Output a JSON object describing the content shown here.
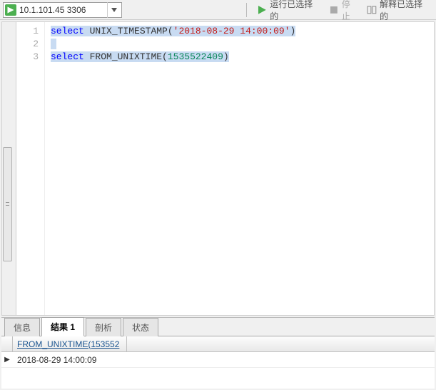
{
  "toolbar": {
    "connection": "10.1.101.45 3306",
    "run_label": "运行已选择的",
    "stop_label": "停止",
    "explain_label": "解释已选择的"
  },
  "editor": {
    "lines": [
      "1",
      "2",
      "3"
    ],
    "code": {
      "l1_kw": "select",
      "l1_sp1": " ",
      "l1_func": "UNIX_TIMESTAMP",
      "l1_open": "(",
      "l1_arg": "'2018-08-29 14:00:09'",
      "l1_close": ")",
      "l3_kw": "select",
      "l3_sp1": " ",
      "l3_func": "FROM_UNIXTIME",
      "l3_open": "(",
      "l3_arg": "1535522409",
      "l3_close": ")"
    }
  },
  "tabs": {
    "info": "信息",
    "result1": "结果 1",
    "profile": "剖析",
    "status": "状态"
  },
  "result": {
    "column": "FROM_UNIXTIME(153552",
    "value": "2018-08-29 14:00:09",
    "row_marker": "▶"
  }
}
